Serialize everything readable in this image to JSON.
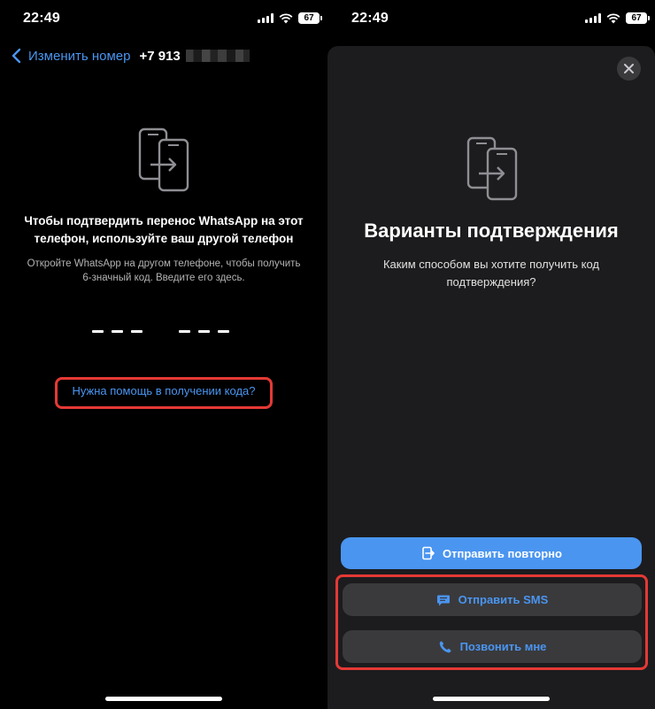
{
  "left": {
    "status": {
      "time": "22:49",
      "battery": "67"
    },
    "nav": {
      "back_label": "Изменить номер",
      "phone_number": "+7 913"
    },
    "title": "Чтобы подтвердить перенос WhatsApp на этот телефон, используйте ваш другой телефон",
    "subtitle": "Откройте WhatsApp на другом телефоне, чтобы получить 6-значный код. Введите его здесь.",
    "help_link": "Нужна помощь в получении кода?"
  },
  "right": {
    "status": {
      "time": "22:49",
      "battery": "67"
    },
    "title": "Варианты подтверждения",
    "subtitle": "Каким способом вы хотите получить код подтверждения?",
    "buttons": {
      "resend": "Отправить повторно",
      "sms": "Отправить SMS",
      "call": "Позвонить мне"
    }
  },
  "colors": {
    "accent": "#4a95f0",
    "highlight": "#e53935",
    "sheet": "#1c1c1e"
  },
  "icons": [
    "chevron-left-icon",
    "phone-transfer-icon",
    "close-icon",
    "resend-icon",
    "message-icon",
    "phone-icon",
    "signal-icon",
    "wifi-icon",
    "battery-icon"
  ]
}
